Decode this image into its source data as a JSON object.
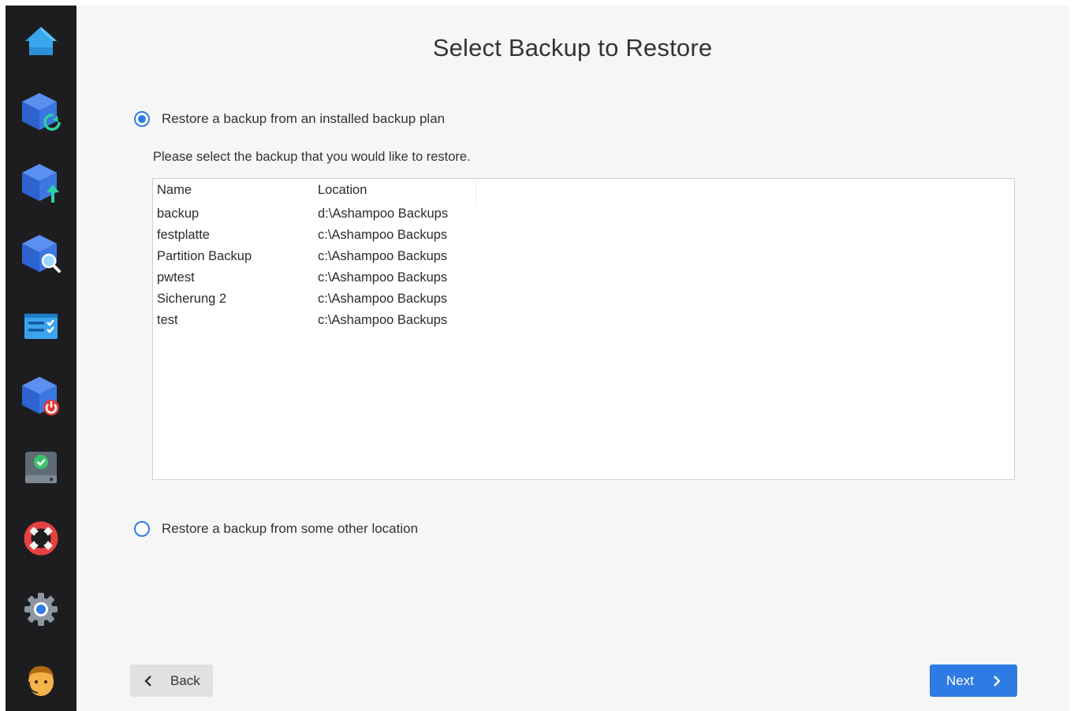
{
  "page": {
    "title": "Select Backup to Restore",
    "option_installed_label": "Restore a backup from an installed backup plan",
    "instruction": "Please select the backup that you would like to restore.",
    "option_other_label": "Restore a backup from some other location"
  },
  "table": {
    "headers": {
      "name": "Name",
      "location": "Location"
    },
    "rows": [
      {
        "name": "backup",
        "location": "d:\\Ashampoo Backups"
      },
      {
        "name": "festplatte",
        "location": "c:\\Ashampoo Backups"
      },
      {
        "name": "Partition Backup",
        "location": "c:\\Ashampoo Backups"
      },
      {
        "name": "pwtest",
        "location": "c:\\Ashampoo Backups"
      },
      {
        "name": "Sicherung 2",
        "location": "c:\\Ashampoo Backups"
      },
      {
        "name": "test",
        "location": "c:\\Ashampoo Backups"
      }
    ]
  },
  "buttons": {
    "back": "Back",
    "next": "Next"
  },
  "sidebar": {
    "icons": [
      "home-icon",
      "backup-refresh-icon",
      "backup-upload-icon",
      "backup-search-icon",
      "checklist-icon",
      "backup-power-icon",
      "drive-check-icon",
      "lifebuoy-icon",
      "gear-icon",
      "support-avatar-icon"
    ]
  },
  "colors": {
    "accent": "#2f7be5",
    "sidebar": "#1d1d1f",
    "background": "#f6f6f6"
  }
}
